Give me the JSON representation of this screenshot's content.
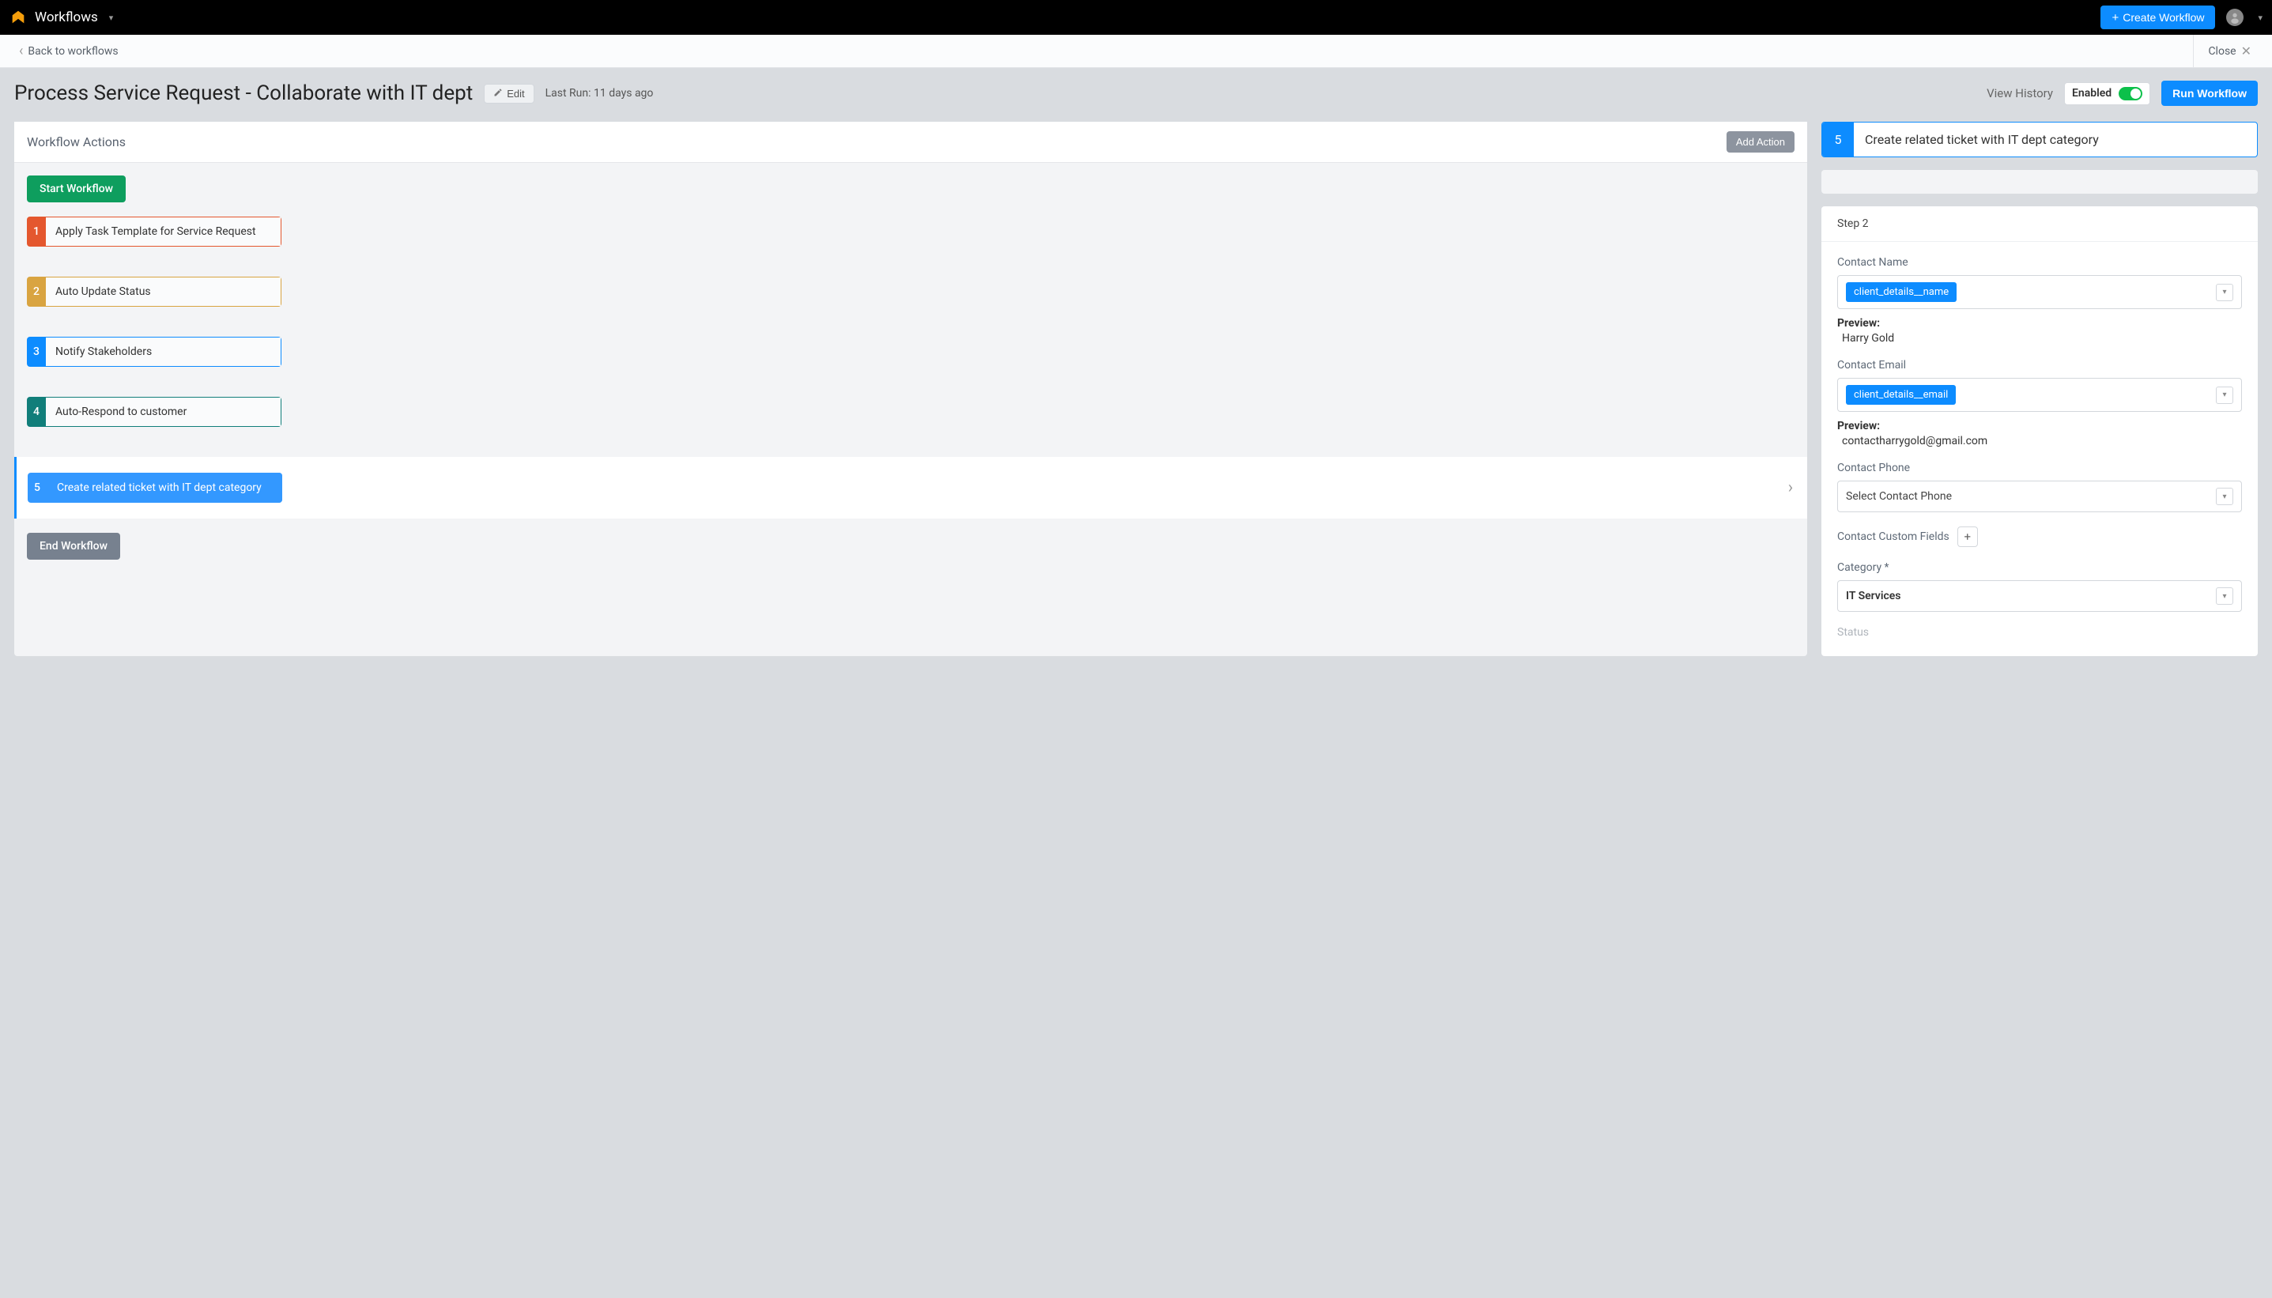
{
  "nav": {
    "title": "Workflows",
    "create_button": "Create Workflow"
  },
  "breadcrumb": {
    "back": "Back to workflows",
    "close": "Close"
  },
  "header": {
    "title": "Process Service Request - Collaborate with IT dept",
    "edit_label": "Edit",
    "last_run": "Last Run: 11 days ago",
    "view_history": "View History",
    "enabled_label": "Enabled",
    "run_button": "Run Workflow"
  },
  "actions_panel": {
    "title": "Workflow Actions",
    "add_button": "Add Action",
    "start_label": "Start Workflow",
    "end_label": "End Workflow",
    "items": [
      {
        "num": "1",
        "label": "Apply Task Template for Service Request"
      },
      {
        "num": "2",
        "label": "Auto Update Status"
      },
      {
        "num": "3",
        "label": "Notify Stakeholders"
      },
      {
        "num": "4",
        "label": "Auto-Respond to customer"
      },
      {
        "num": "5",
        "label": "Create related ticket with IT dept category"
      }
    ]
  },
  "detail": {
    "num": "5",
    "title": "Create related ticket with IT dept category",
    "step_label": "Step 2",
    "contact_name": {
      "label": "Contact Name",
      "token": "client_details__name",
      "preview_label": "Preview:",
      "preview_value": "Harry Gold"
    },
    "contact_email": {
      "label": "Contact Email",
      "token": "client_details__email",
      "preview_label": "Preview:",
      "preview_value": "contactharrygold@gmail.com"
    },
    "contact_phone": {
      "label": "Contact Phone",
      "placeholder": "Select Contact Phone"
    },
    "custom_fields": {
      "label": "Contact Custom Fields"
    },
    "category": {
      "label": "Category *",
      "value": "IT Services"
    },
    "status": {
      "label": "Status"
    }
  }
}
